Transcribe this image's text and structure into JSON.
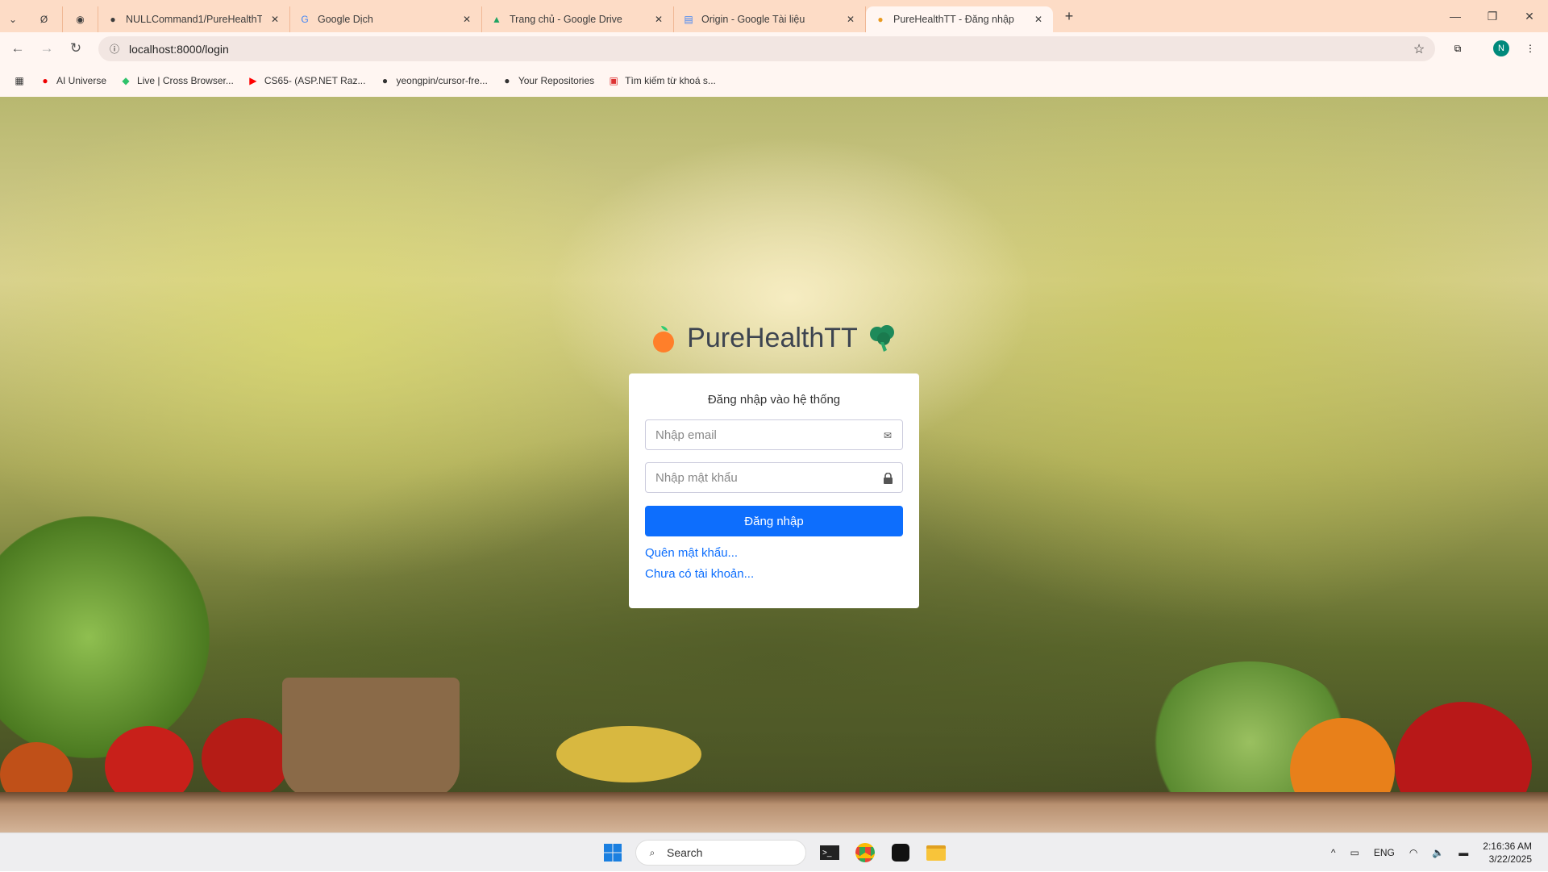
{
  "browser": {
    "tabs": [
      {
        "title": "NULLCommand1/PureHealthTT",
        "icon": "github-icon"
      },
      {
        "title": "Google Dịch",
        "icon": "google-translate-icon"
      },
      {
        "title": "Trang chủ - Google Drive",
        "icon": "google-drive-icon"
      },
      {
        "title": "Origin - Google Tài liệu",
        "icon": "google-docs-icon"
      },
      {
        "title": "PureHealthTT - Đăng nhập",
        "icon": "site-favicon",
        "active": true
      }
    ],
    "url": "localhost:8000/login",
    "profile_initial": "N",
    "bookmarks": [
      {
        "label": "AI Universe",
        "icon": "red-circle-icon"
      },
      {
        "label": "Live | Cross Browser...",
        "icon": "lambdatest-icon"
      },
      {
        "label": "CS65- (ASP.NET Raz...",
        "icon": "youtube-icon"
      },
      {
        "label": "yeongpin/cursor-fre...",
        "icon": "github-icon"
      },
      {
        "label": "Your Repositories",
        "icon": "github-icon"
      },
      {
        "label": "Tìm kiếm từ khoá s...",
        "icon": "bookmark-icon"
      }
    ]
  },
  "page": {
    "brand": "PureHealthTT",
    "login_title": "Đăng nhập vào hệ thống",
    "email_placeholder": "Nhập email",
    "password_placeholder": "Nhập mật khẩu",
    "submit_label": "Đăng nhập",
    "forgot_link": "Quên mật khẩu...",
    "register_link": "Chưa có tài khoản...",
    "accent_color": "#0d6efd"
  },
  "taskbar": {
    "search_placeholder": "Search",
    "language": "ENG",
    "time": "2:16:36 AM",
    "date": "3/22/2025"
  }
}
